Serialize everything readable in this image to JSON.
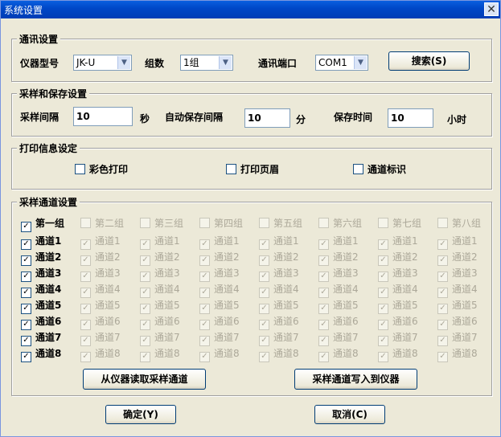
{
  "window": {
    "title": "系统设置",
    "close_glyph": "✕"
  },
  "comm": {
    "title": "通讯设置",
    "model_label": "仪器型号",
    "model_value": "JK-U",
    "groups_label": "组数",
    "groups_value": "1组",
    "port_label": "通讯端口",
    "port_value": "COM1",
    "search_label": "搜索(S)"
  },
  "save": {
    "title": "采样和保存设置",
    "interval_label": "采样间隔",
    "interval_value": "10",
    "interval_unit": "秒",
    "autosave_label": "自动保存间隔",
    "autosave_value": "10",
    "autosave_unit": "分",
    "savetime_label": "保存时间",
    "savetime_value": "10",
    "savetime_unit": "小时"
  },
  "print": {
    "title": "打印信息设定",
    "options": [
      "彩色打印",
      "打印页眉",
      "通道标识"
    ]
  },
  "channels": {
    "title": "采样通道设置",
    "groups": [
      "第一组",
      "第二组",
      "第三组",
      "第四组",
      "第五组",
      "第六组",
      "第七组",
      "第八组"
    ],
    "channel_labels": [
      "通道1",
      "通道2",
      "通道3",
      "通道4",
      "通道5",
      "通道6",
      "通道7",
      "通道8"
    ],
    "group1_checked": true,
    "read_button": "从仪器读取采样通道",
    "write_button": "采样通道写入到仪器"
  },
  "footer": {
    "ok_label": "确定(Y)",
    "cancel_label": "取消(C)"
  },
  "check_glyph": "✓"
}
